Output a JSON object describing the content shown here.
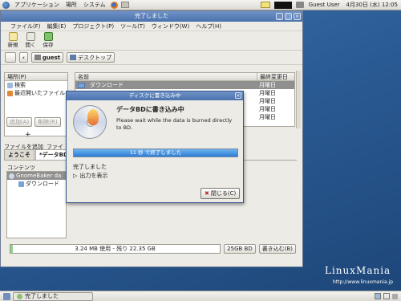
{
  "top_panel": {
    "menus": [
      "アプリケーション",
      "場所",
      "システム"
    ],
    "user": "Guest User",
    "datetime": "4月30日 (水) 12:05"
  },
  "window": {
    "title": "完了しました",
    "menubar": [
      "ファイル(F)",
      "編集(E)",
      "プロジェクト(P)",
      "ツール(T)",
      "ウィンドウ(W)",
      "ヘルプ(H)"
    ],
    "toolbar": [
      {
        "label": "新規",
        "icon": "new-project-icon"
      },
      {
        "label": "開く",
        "icon": "open-icon"
      },
      {
        "label": "保存",
        "icon": "save-icon"
      }
    ],
    "path": [
      "guest",
      "デスクトップ"
    ],
    "side_header": "場所(P)",
    "side_items": [
      "検索",
      "最近開いたファイル"
    ],
    "file_columns": [
      "名前",
      "最終変更日"
    ],
    "files": [
      {
        "name": "ダウンロード",
        "modified": "月曜日",
        "selected": true
      },
      {
        "name": "",
        "modified": "月曜日",
        "selected": false
      },
      {
        "name": "",
        "modified": "月曜日",
        "selected": false
      },
      {
        "name": "",
        "modified": "月曜日",
        "selected": false
      },
      {
        "name": "",
        "modified": "月曜日",
        "selected": false
      }
    ],
    "gb_buttons": [
      "追加(A)",
      "削除(R)"
    ],
    "gb_toolbar": [
      "ファイルを追加",
      "ファイ"
    ],
    "tabs": [
      "ようこそ",
      "*データBD"
    ],
    "contents_label": "コンテンツ",
    "tree": [
      {
        "label": "GnomeBaker da",
        "selected": true
      },
      {
        "label": "ダウンロード",
        "selected": false
      }
    ],
    "capacity_text": "3.24 MB 使用 - 残り 22.35 GB",
    "capacity_fraction": 0.0,
    "disc_size": "25GB BD",
    "burn_button": "書き込む(B)"
  },
  "dialog": {
    "title": "ディスクに書き込み中",
    "heading": "データBDに書き込み中",
    "message": "Please wait while the data is burned directly to BD.",
    "progress_text": "11 秒 で終了しました",
    "progress_fraction": 1.0,
    "done_label": "完了しました",
    "output_label": "出力を表示",
    "close_label": "閉じる(C)"
  },
  "bottom_panel": {
    "task": "完了しました"
  },
  "branding": {
    "logo": "LinuxMania",
    "url": "http://www.linuxmania.jp"
  }
}
